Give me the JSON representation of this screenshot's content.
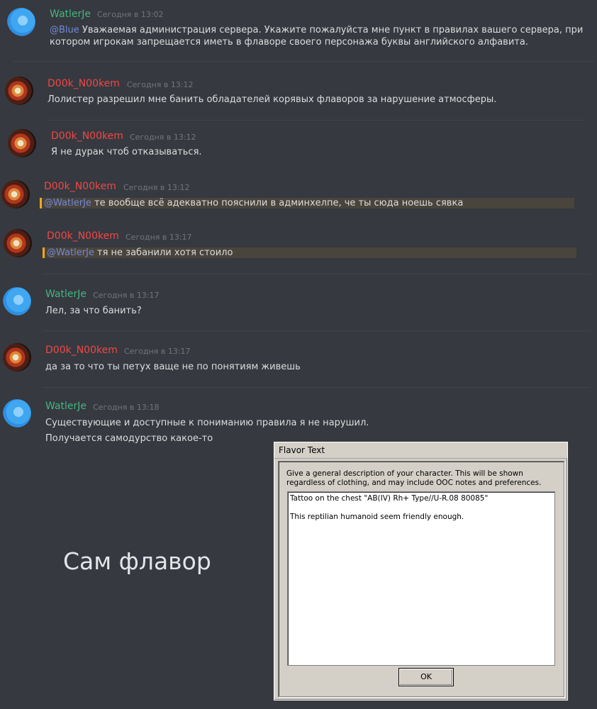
{
  "messages": [
    {
      "author": "WatlerJe",
      "time": "Сегодня в 13:02",
      "mention": "@Blue",
      "lines": [
        "Уважаемая администрация сервера. Укажите пожалуйста мне пункт в правилах вашего сервера, при",
        "котором игрокам запрещается иметь в флаворе своего персонажа буквы английского алфавита."
      ]
    },
    {
      "author": "D00k_N00kem",
      "time": "Сегодня в 13:12",
      "text": "Лолистер разрешил мне банить обладателей корявых флаворов за нарушение атмосферы."
    },
    {
      "author": "D00k_N00kem",
      "time": "Сегодня в 13:12",
      "text": "Я не дурак чтоб отказываться."
    },
    {
      "author": "D00k_N00kem",
      "time": "Сегодня в 13:12",
      "mention": "@WatlerJe",
      "text": "те вообще всё адекватно пояснили в админхелпе, че ты сюда ноешь сявка"
    },
    {
      "author": "D00k_N00kem",
      "time": "Сегодня в 13:17",
      "mention": "@WatlerJe",
      "text": "тя не забанили хотя стоило"
    },
    {
      "author": "WatlerJe",
      "time": "Сегодня в 13:17",
      "text": "Лел, за что банить?"
    },
    {
      "author": "D00k_N00kem",
      "time": "Сегодня в 13:17",
      "text": "да за то что ты петух ваще не по понятиям живешь"
    },
    {
      "author": "WatlerJe",
      "time": "Сегодня в 13:18",
      "lines": [
        "Существующие и доступные к пониманию правила я не нарушил.",
        "Получается самодурство какое-то"
      ]
    }
  ],
  "caption": "Сам флавор",
  "flavor_window": {
    "title": "Flavor Text",
    "description": "Give a general description of your character. This will be shown regardless of clothing, and may include OOC notes and preferences.",
    "text_lines": [
      "Tattoo on the chest \"AB(IV) Rh+ Type//U-R.08 80085\"",
      "This reptilian humanoid seem friendly enough."
    ],
    "ok_label": "OK"
  },
  "colors": {
    "background": "#36393f",
    "author_green": "#43b581",
    "author_red": "#f04747",
    "mention": "#7289da",
    "highlight_bar": "#faa61a"
  }
}
